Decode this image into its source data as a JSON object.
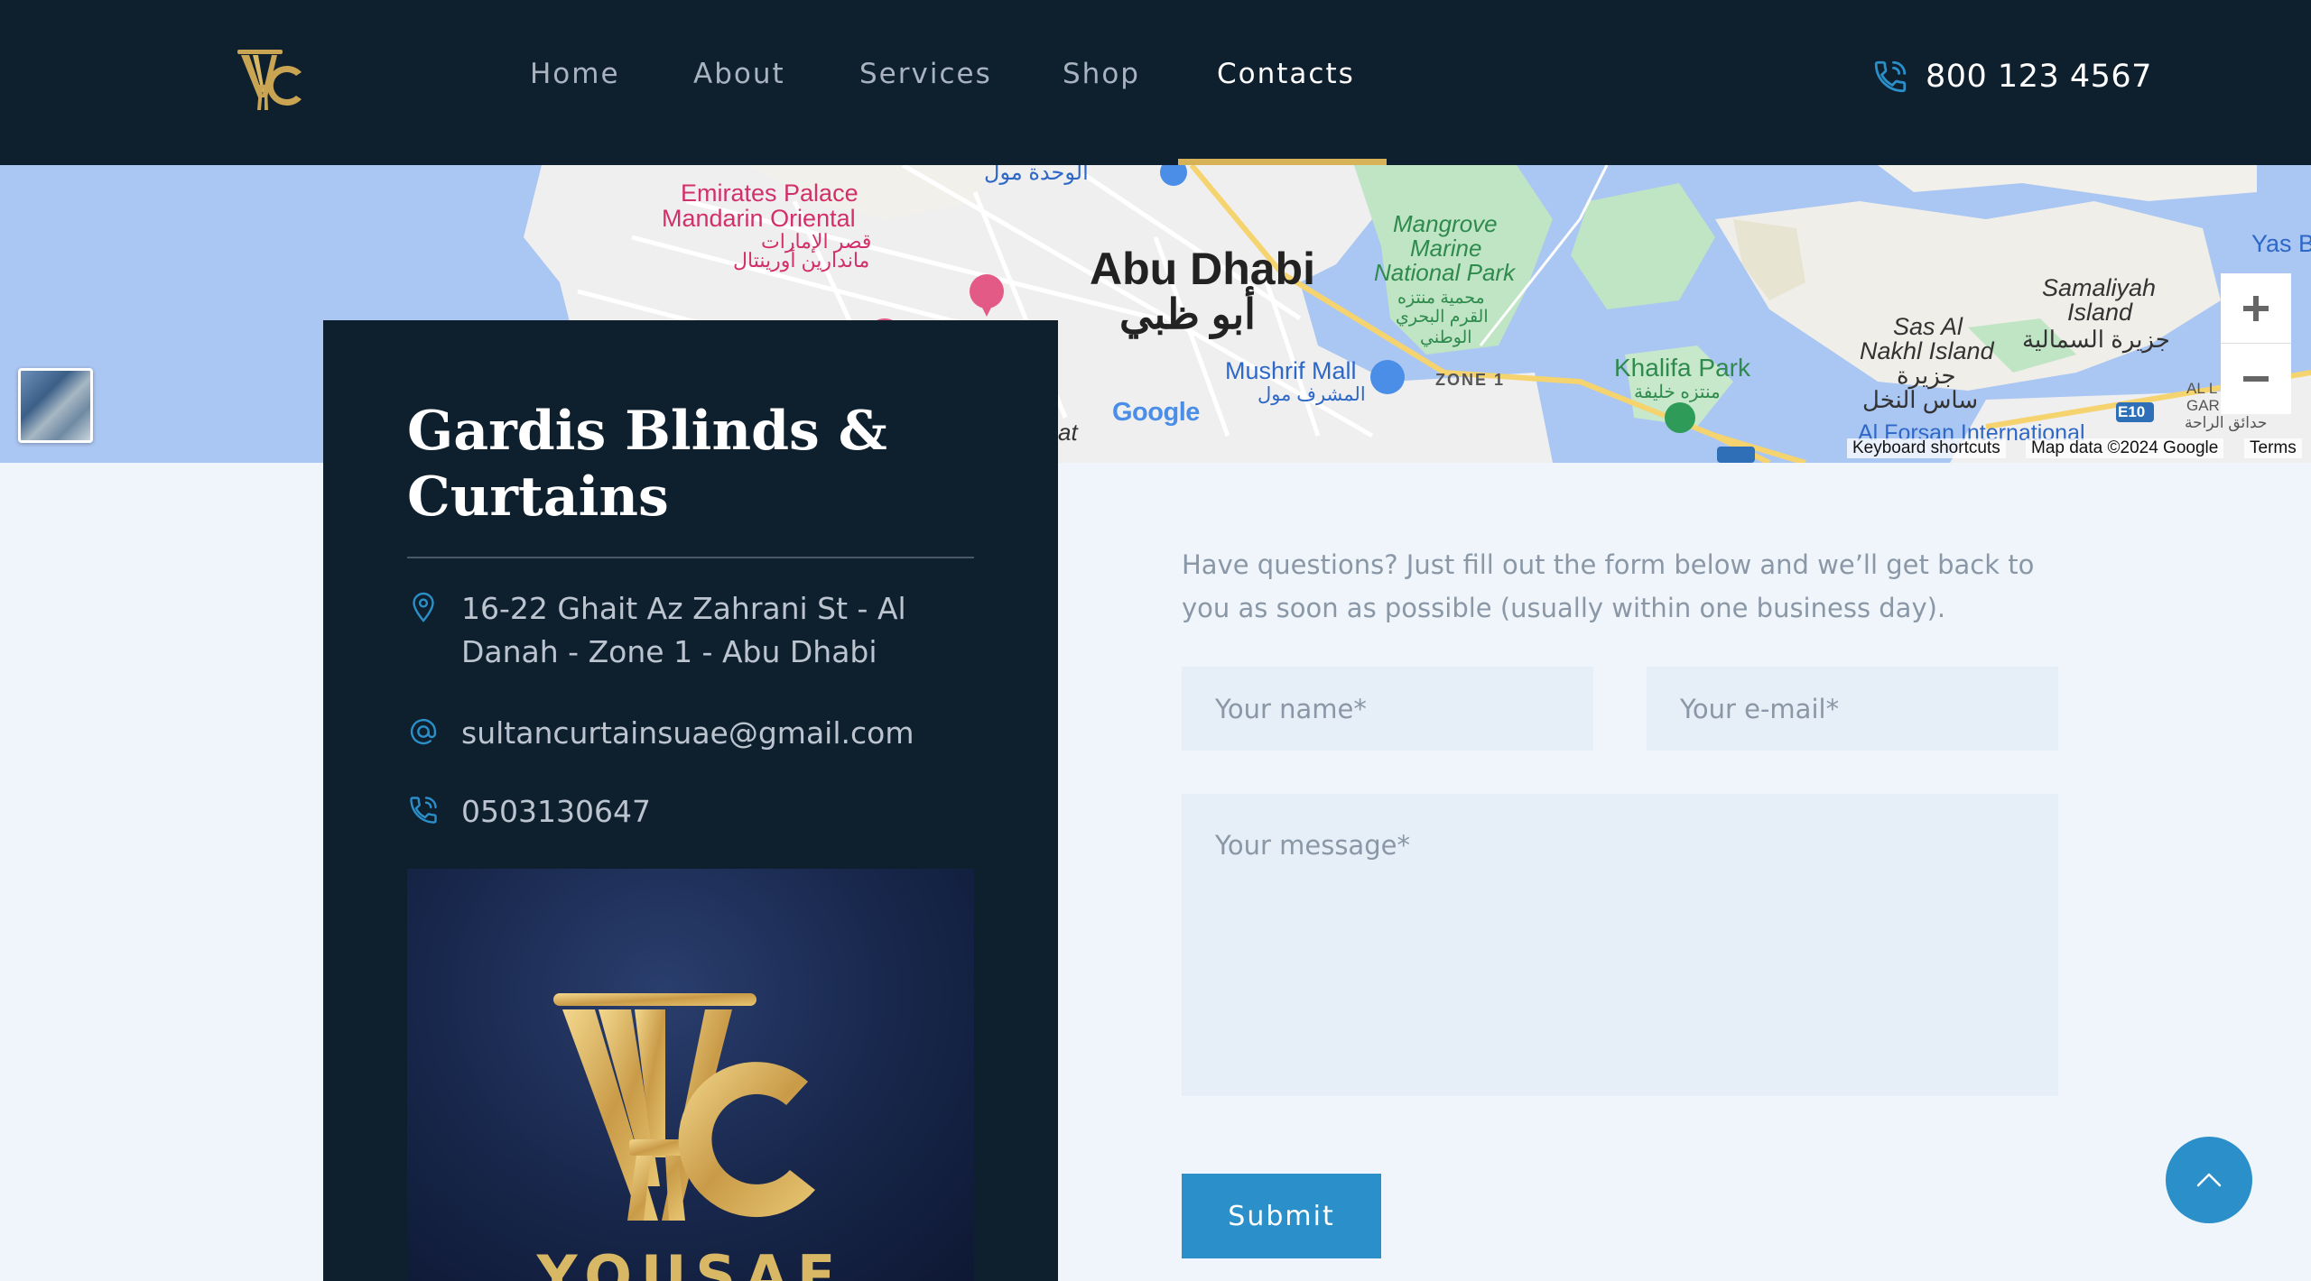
{
  "header": {
    "nav": [
      {
        "label": "Home"
      },
      {
        "label": "About"
      },
      {
        "label": "Services"
      },
      {
        "label": "Shop"
      },
      {
        "label": "Contacts"
      }
    ],
    "active_nav": "Contacts",
    "phone": "800 123 4567"
  },
  "map": {
    "labels": {
      "emirates_palace": "Emirates Palace",
      "mandarin_oriental": "Mandarin Oriental",
      "emirates_palace_ar": "قصر الإمارات",
      "mandarin_ar": "ماندارين أورينتال",
      "wahda_mall_ar": "الوحدة مول",
      "abu_dhabi": "Abu Dhabi",
      "abu_dhabi_ar": "أبو ظبي",
      "mangrove_1": "Mangrove",
      "mangrove_2": "Marine",
      "mangrove_3": "National Park",
      "mangrove_ar_1": "محمية منتزه",
      "mangrove_ar_2": "القرم البحري",
      "mangrove_ar_3": "الوطني",
      "mushrif_mall": "Mushrif Mall",
      "mushrif_mall_ar": "المشرف مول",
      "zone_1": "ZONE 1",
      "khalifa_park": "Khalifa Park",
      "khalifa_park_ar": "منتزه خليفة",
      "sas_al_1": "Sas Al",
      "sas_al_2": "Nakhl Island",
      "sas_al_ar_1": "جزيرة",
      "sas_al_ar_2": "ساس النخل",
      "samaliyah_1": "Samaliyah",
      "samaliyah_2": "Island",
      "samaliyah_ar": "جزيرة السمالية",
      "yas": "Yas B",
      "al_forsan": "Al Forsan International",
      "e10": "E10",
      "al_gar": "AL L GAR",
      "hadaiq_ar": "حدائق الراحة",
      "left_edge": "at"
    },
    "google": "Google",
    "footer": {
      "shortcuts": "Keyboard shortcuts",
      "data": "Map data ©2024 Google",
      "terms": "Terms"
    },
    "zoom_in_icon": "plus-icon",
    "zoom_out_icon": "minus-icon"
  },
  "card": {
    "title": "Gardis Blinds & Curtains",
    "address": "16-22 Ghait Az Zahrani St - Al Danah - Zone 1 - Abu Dhabi",
    "email": "sultancurtainsuae@gmail.com",
    "phone": "0503130647",
    "logo_text": "YOUSAF"
  },
  "form": {
    "intro": "Have questions? Just fill out the form below and we’ll get back to you as soon as possible (usually within one business day).",
    "name_placeholder": "Your name*",
    "email_placeholder": "Your e-mail*",
    "message_placeholder": "Your message*",
    "submit_label": "Submit"
  },
  "colors": {
    "header_bg": "#0e1f2e",
    "accent_gold": "#d7b257",
    "accent_blue": "#2b8fc9",
    "page_bg": "#f0f5fb",
    "field_bg": "#e6eef7"
  }
}
